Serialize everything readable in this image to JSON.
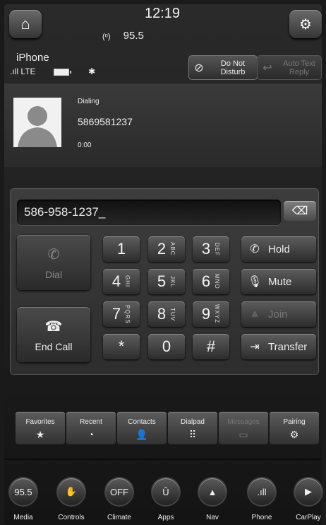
{
  "status": {
    "time": "12:19",
    "radio_icon": "(ᵒ)",
    "radio_freq": "95.5",
    "device": "iPhone",
    "network": "LTE",
    "signal_icon": ".ıll",
    "bt_icon": "✱"
  },
  "header": {
    "home_icon": "⌂",
    "settings_icon": "⚙",
    "dnd_icon": "⊘",
    "dnd_line1": "Do Not",
    "dnd_line2": "Disturb",
    "auto_icon": "↩",
    "auto_line1": "Auto Text",
    "auto_line2": "Reply"
  },
  "call": {
    "status": "Dialing",
    "number": "5869581237",
    "timer": "0:00"
  },
  "dialer": {
    "entry": "586-958-1237_",
    "backspace_icon": "⌫",
    "dial_label": "Dial",
    "end_label": "End Call",
    "dial_icon": "✆",
    "end_icon": "☎",
    "keys": [
      {
        "d": "1",
        "l": ""
      },
      {
        "d": "2",
        "l": "ABC"
      },
      {
        "d": "3",
        "l": "DEF"
      },
      {
        "d": "4",
        "l": "GHI"
      },
      {
        "d": "5",
        "l": "JKL"
      },
      {
        "d": "6",
        "l": "MNO"
      },
      {
        "d": "7",
        "l": "PQRS"
      },
      {
        "d": "8",
        "l": "TUV"
      },
      {
        "d": "9",
        "l": "WXYZ"
      },
      {
        "d": "*",
        "l": ""
      },
      {
        "d": "0",
        "l": ""
      },
      {
        "d": "#",
        "l": ""
      }
    ],
    "side": [
      {
        "icon": "✆",
        "label": "Hold"
      },
      {
        "icon": "🎙",
        "label": "Mute"
      },
      {
        "icon": "⩓",
        "label": "Join"
      },
      {
        "icon": "⇥",
        "label": "Transfer"
      }
    ]
  },
  "tabs": [
    {
      "label": "Favorites",
      "icon": "★"
    },
    {
      "label": "Recent",
      "icon": "◔"
    },
    {
      "label": "Contacts",
      "icon": "👤"
    },
    {
      "label": "Dialpad",
      "icon": "⠿"
    },
    {
      "label": "Messages",
      "icon": "▭"
    },
    {
      "label": "Pairing",
      "icon": "⚙"
    }
  ],
  "dock": [
    {
      "label": "Media",
      "icon": "95.5"
    },
    {
      "label": "Controls",
      "icon": "✋"
    },
    {
      "label": "Climate",
      "icon": "OFF"
    },
    {
      "label": "Apps",
      "icon": "Û"
    },
    {
      "label": "Nav",
      "icon": "▲"
    },
    {
      "label": "Phone",
      "icon": ".ıll"
    },
    {
      "label": "CarPlay",
      "icon": "▶"
    }
  ]
}
